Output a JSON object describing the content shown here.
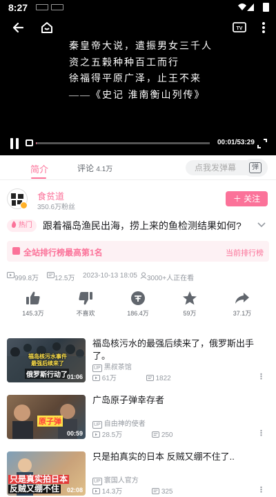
{
  "status_bar": {
    "time": "8:27"
  },
  "player": {
    "subtitle_lines": [
      "秦皇帝大说，遣振男女三千人",
      "资之五榖种种百工而行",
      "徐福得平原广泽，止王不来",
      "——《史记 淮南衡山列传》"
    ],
    "current_time": "00:01",
    "total_time": "53:29",
    "time_display": "00:01/53:29",
    "progress_fraction": 0.0003
  },
  "tabs": {
    "intro": "简介",
    "comments": "评论",
    "comment_count": "4.1万",
    "danmaku_placeholder": "点我发弹幕",
    "danmaku_icon": "弹"
  },
  "uploader": {
    "name": "食贫道",
    "fans": "350.6万粉丝",
    "follow_label": "关注",
    "follow_plus": "＋"
  },
  "video": {
    "hot_badge": "热门",
    "title": "跟着福岛渔民出海，捞上来的鱼检测结果如何?",
    "rank_text": "全站排行榜最高第1名",
    "rank_link": "当前排行榜",
    "views": "999.8万",
    "danmaku": "12.5万",
    "date": "2023-10-13 18:05",
    "watching": "3000+人正在看"
  },
  "actions": [
    {
      "name": "like",
      "label": "145.3万"
    },
    {
      "name": "dislike",
      "label": "不喜欢"
    },
    {
      "name": "coin",
      "label": "186.4万"
    },
    {
      "name": "favorite",
      "label": "59万"
    },
    {
      "name": "share",
      "label": "37.1万"
    }
  ],
  "recommendations": [
    {
      "title": "福岛核污水的最强后续来了，俄罗斯出手了。",
      "uploader": "黑叔茶馆",
      "views": "61万",
      "danmaku": "1822",
      "duration": "01:06",
      "thumb_text": "福岛核污水事件最强后续来了",
      "thumb_sub": "俄罗斯行动了"
    },
    {
      "title": "广岛原子弹幸存者",
      "uploader": "自由神的使者",
      "views": "28.5万",
      "danmaku": "250",
      "duration": "00:59",
      "thumb_text": "原子弹",
      "thumb_sub": ""
    },
    {
      "title": "只是拍真实的日本 反贼又绷不住了..",
      "uploader": "寰国人官方",
      "views": "14.3万",
      "danmaku": "325",
      "duration": "02:08",
      "thumb_text": "只是真实拍日本",
      "thumb_sub": "反贼又绷不住"
    }
  ],
  "up_tag": "UP",
  "colors": {
    "accent": "#fb7299",
    "gray": "#9499a0"
  }
}
